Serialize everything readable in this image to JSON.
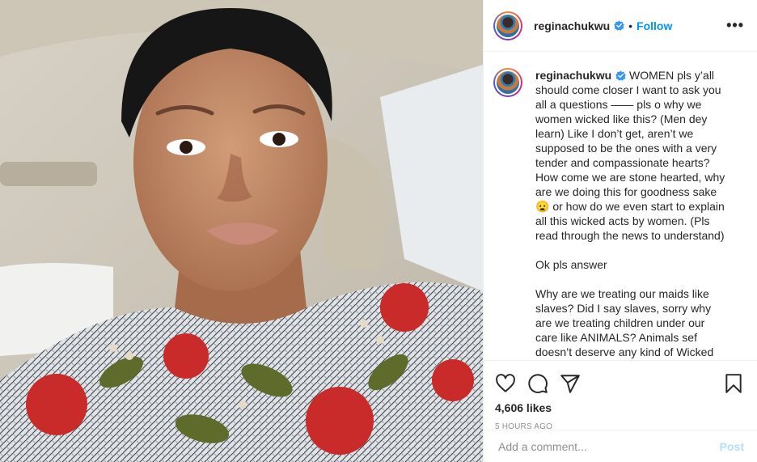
{
  "post": {
    "username": "reginachukwu",
    "follow_label": "Follow",
    "more_label": "•••",
    "caption": {
      "username": "reginachukwu",
      "paragraphs": [
        "WOMEN pls y’all should come closer I want to ask you all a questions —— pls o why we women wicked like this? (Men dey learn) Like I don’t get, aren’t we supposed to be the ones with a very tender and compassionate hearts? How come we are stone hearted, why are we doing this for goodness sake 😦 or how do we even start to explain all this wicked acts by women. (Pls read through the news to understand)",
        "Ok pls answer",
        "Why are we treating our maids like slaves? Did I say slaves, sorry why are we treating children under our care like ANIMALS? Animals sef doesn’t deserve any kind of Wicked"
      ]
    },
    "likes": "4,606 likes",
    "time": "5 HOURS AGO",
    "comment_placeholder": "Add a comment...",
    "post_button": "Post"
  },
  "icons": {
    "like": "heart-icon",
    "comment": "comment-icon",
    "share": "share-icon",
    "save": "bookmark-icon",
    "verified": "verified-badge-icon"
  },
  "colors": {
    "accent": "#0095f6",
    "verified": "#3897f0",
    "post_disabled": "#b2dffc",
    "muted": "#8e8e8e"
  }
}
